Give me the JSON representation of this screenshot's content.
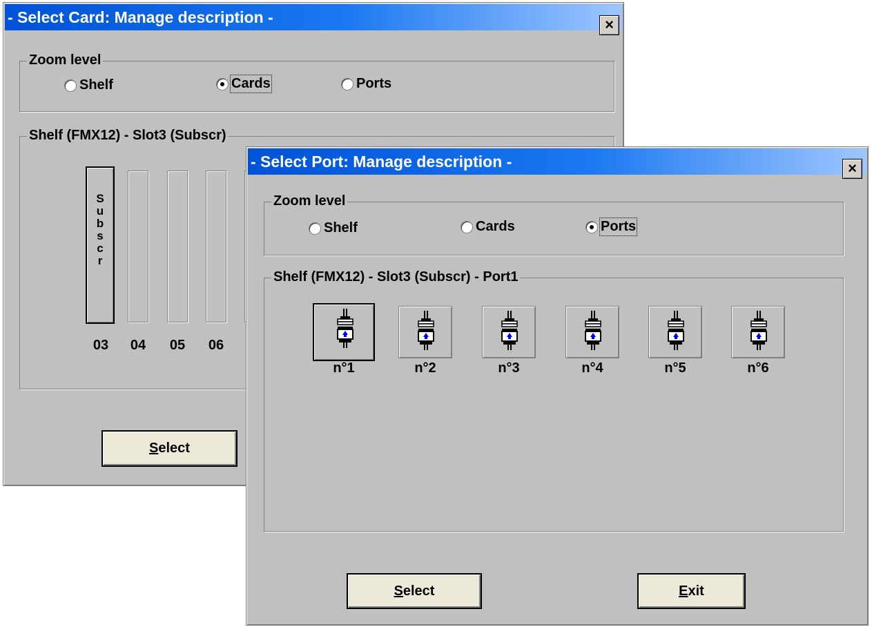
{
  "card_window": {
    "title": "- Select Card: Manage description -",
    "close_label": "×",
    "zoom_group_label": "Zoom level",
    "zoom_options": [
      {
        "label": "Shelf",
        "selected": false
      },
      {
        "label": "Cards",
        "selected": true
      },
      {
        "label": "Ports",
        "selected": false
      }
    ],
    "shelf_group_label": "Shelf (FMX12) - Slot3 (Subscr)",
    "slots": [
      {
        "number": "03",
        "text": "S\nu\nb\ns\nc\nr",
        "selected": true
      },
      {
        "number": "04",
        "text": "",
        "selected": false
      },
      {
        "number": "05",
        "text": "",
        "selected": false
      },
      {
        "number": "06",
        "text": "",
        "selected": false
      }
    ],
    "select_button": {
      "mnemonic": "S",
      "rest": "elect"
    }
  },
  "port_window": {
    "title": "- Select Port: Manage description -",
    "close_label": "×",
    "zoom_group_label": "Zoom level",
    "zoom_options": [
      {
        "label": "Shelf",
        "selected": false
      },
      {
        "label": "Cards",
        "selected": false
      },
      {
        "label": "Ports",
        "selected": true
      }
    ],
    "shelf_group_label": "Shelf (FMX12) - Slot3 (Subscr) - Port1",
    "ports": [
      {
        "label": "n°1",
        "selected": true
      },
      {
        "label": "n°2",
        "selected": false
      },
      {
        "label": "n°3",
        "selected": false
      },
      {
        "label": "n°4",
        "selected": false
      },
      {
        "label": "n°5",
        "selected": false
      },
      {
        "label": "n°6",
        "selected": false
      }
    ],
    "select_button": {
      "mnemonic": "S",
      "rest": "elect"
    },
    "exit_button": {
      "mnemonic": "E",
      "rest": "xit"
    }
  },
  "colors": {
    "titlebar_start": "#0052d6",
    "titlebar_end": "#9ec6ff",
    "window_face": "#c0c0c0",
    "port_icon_accent": "#0000ff"
  }
}
